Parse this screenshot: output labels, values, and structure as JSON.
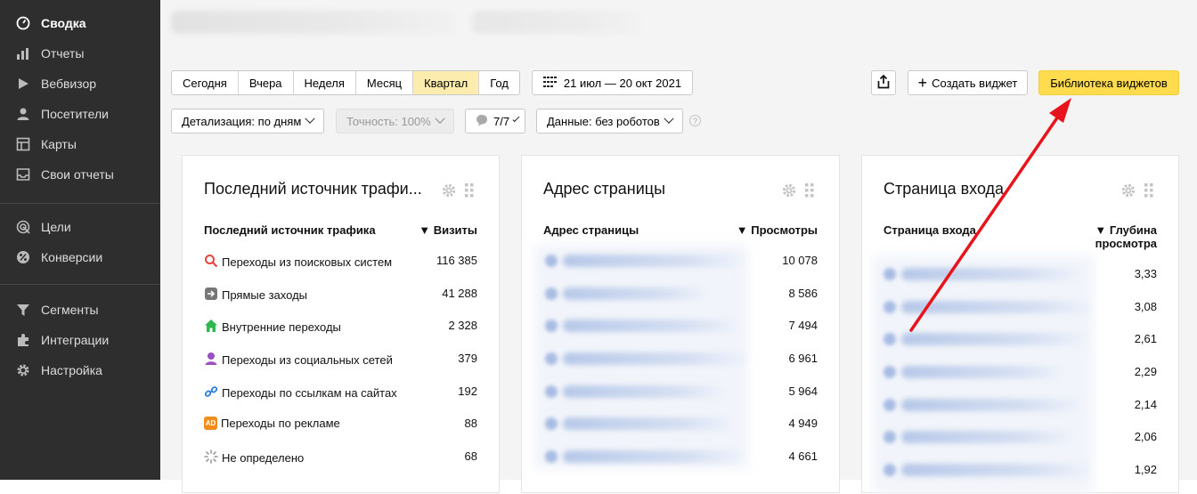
{
  "sidebar": {
    "items": [
      {
        "label": "Сводка",
        "icon": "gauge-icon"
      },
      {
        "label": "Отчеты",
        "icon": "bar-chart-icon"
      },
      {
        "label": "Вебвизор",
        "icon": "play-icon"
      },
      {
        "label": "Посетители",
        "icon": "user-icon"
      },
      {
        "label": "Карты",
        "icon": "map-icon"
      },
      {
        "label": "Свои отчеты",
        "icon": "inbox-icon"
      },
      {
        "label": "Цели",
        "icon": "target-icon"
      },
      {
        "label": "Конверсии",
        "icon": "percent-icon"
      },
      {
        "label": "Сегменты",
        "icon": "filter-icon"
      },
      {
        "label": "Интеграции",
        "icon": "puzzle-icon"
      },
      {
        "label": "Настройка",
        "icon": "gear-icon"
      }
    ]
  },
  "toolbar": {
    "periods": [
      "Сегодня",
      "Вчера",
      "Неделя",
      "Месяц",
      "Квартал",
      "Год"
    ],
    "selected_period": "Квартал",
    "date_range": "21 июл — 20 окт 2021",
    "create_widget": "Создать виджет",
    "widget_library": "Библиотека виджетов"
  },
  "filters": {
    "detail": "Детализация: по дням",
    "accuracy": "Точность: 100%",
    "goals": "7/7",
    "data": "Данные: без роботов",
    "help": "?"
  },
  "cards": {
    "sources": {
      "title": "Последний источник трафи...",
      "col_label": "Последний источник трафика",
      "col_value": "▼ Визиты",
      "rows": [
        {
          "label": "Переходы из поисковых систем",
          "value": "116 385",
          "icon": "search-icon"
        },
        {
          "label": "Прямые заходы",
          "value": "41 288",
          "icon": "arrow-right-icon"
        },
        {
          "label": "Внутренние переходы",
          "value": "2 328",
          "icon": "home-icon"
        },
        {
          "label": "Переходы из социальных сетей",
          "value": "379",
          "icon": "social-icon"
        },
        {
          "label": "Переходы по ссылкам на сайтах",
          "value": "192",
          "icon": "link-icon"
        },
        {
          "label": "Переходы по рекламе",
          "value": "88",
          "icon": "ad-icon",
          "icon_text": "AD"
        },
        {
          "label": "Не определено",
          "value": "68",
          "icon": "spinner-icon"
        }
      ]
    },
    "pages": {
      "title": "Адрес страницы",
      "col_label": "Адрес страницы",
      "col_value": "▼ Просмотры",
      "values": [
        "10 078",
        "8 586",
        "7 494",
        "6 961",
        "5 964",
        "4 949",
        "4 661"
      ]
    },
    "entry": {
      "title": "Страница входа",
      "col_label": "Страница входа",
      "col_value_1": "▼ Глубина",
      "col_value_2": "просмотра",
      "values": [
        "3,33",
        "3,08",
        "2,61",
        "2,29",
        "2,14",
        "2,06",
        "1,92"
      ]
    }
  },
  "colors": {
    "sidebar_bg": "#2e2e2e",
    "accent_yellow": "#ffdb4d",
    "selected_period": "#fcecad",
    "annotation_arrow": "#e8141b"
  }
}
